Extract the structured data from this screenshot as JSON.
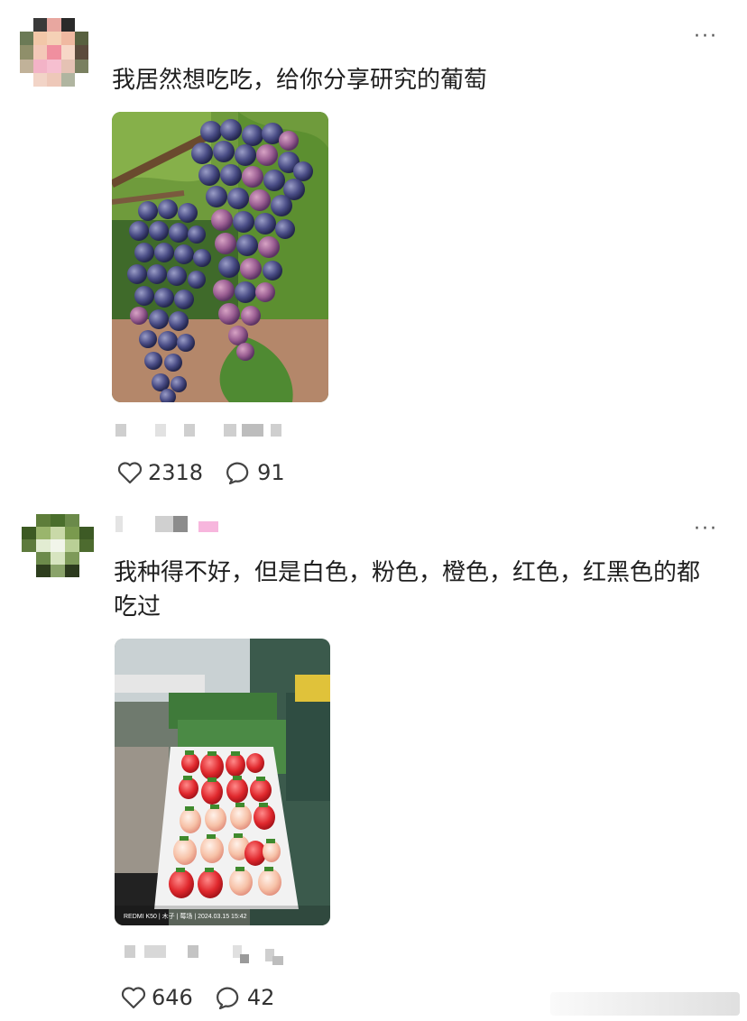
{
  "posts": [
    {
      "text": "我居然想吃吃，给你分享研究的葡萄",
      "more": "···",
      "likes": "2318",
      "comments": "91",
      "photo": "grape-cluster-photo"
    },
    {
      "text": "我种得不好，但是白色，粉色，橙色，红色，红黑色的都吃过",
      "more": "···",
      "likes": "646",
      "comments": "42",
      "photo": "strawberry-tray-photo",
      "photo_caption": "REDMI K50 | 木子 | 莓场 | 2024.03.15 15:42"
    }
  ],
  "icons": {
    "like": "heart-outline-icon",
    "comment": "speech-bubble-icon",
    "more": "ellipsis-icon"
  },
  "colors": {
    "text": "#1f1f1f",
    "meta_gray": "#cfcfcf",
    "pink_badge": "#f7b6dd"
  }
}
